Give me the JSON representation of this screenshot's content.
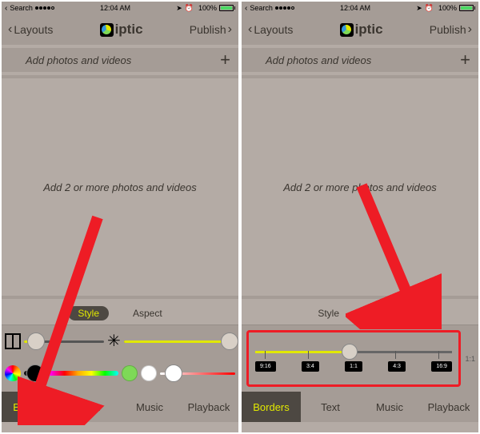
{
  "status": {
    "back_label": "Search",
    "time": "12:04 AM",
    "battery_pct": "100%"
  },
  "nav": {
    "left_label": "Layouts",
    "right_label": "Publish",
    "app_name": "iptic"
  },
  "header_strip": {
    "label": "Add photos and videos",
    "plus": "+"
  },
  "canvas_hint": "Add 2 or more photos and videos",
  "pills": {
    "style": "Style",
    "aspect": "Aspect"
  },
  "left_controls": {
    "border_slider_pct": 15,
    "inner_slider_pct": 95,
    "color_thumb_pct": 12,
    "tint_thumb_pct": 18
  },
  "aspect_control": {
    "slider_pct": 48,
    "ratios": [
      "9:16",
      "3:4",
      "1:1",
      "4:3",
      "16:9"
    ],
    "readout": "1:1"
  },
  "tabs": [
    "Borders",
    "Text",
    "Music",
    "Playback"
  ],
  "icons": {
    "chevron_left": "‹",
    "chevron_right": "›",
    "plus_glyph": "＋",
    "star_glyph": "✳"
  }
}
